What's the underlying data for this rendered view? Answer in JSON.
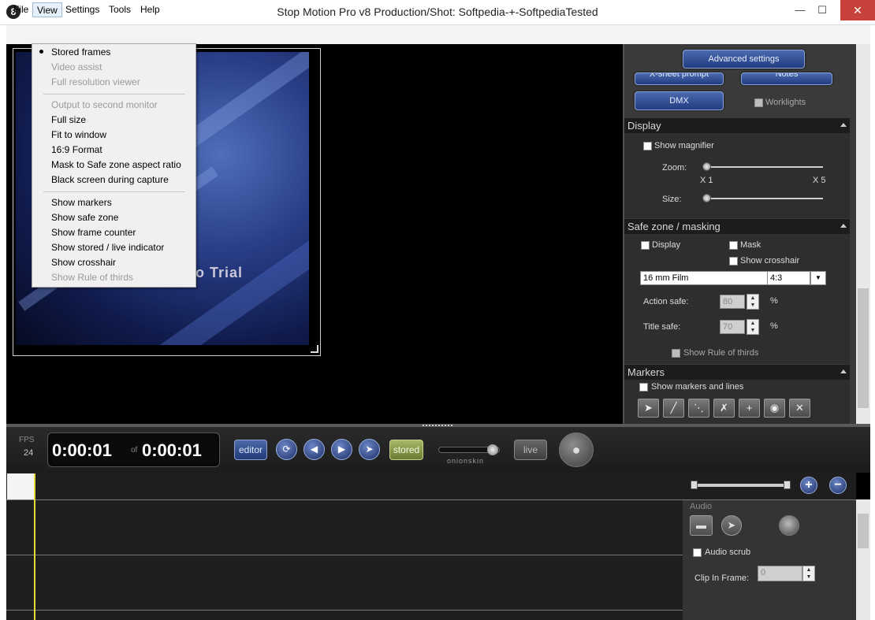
{
  "window": {
    "title": "Stop Motion Pro v8   Production/Shot: Softpedia-+-SoftpediaTested",
    "app_icon_glyph": "8",
    "minimize_glyph": "—",
    "maximize_glyph": "☐",
    "close_glyph": "✕"
  },
  "menubar": {
    "file": "File",
    "view": "View",
    "settings": "Settings",
    "tools": "Tools",
    "help": "Help"
  },
  "view_menu": {
    "stored_frames": "Stored frames",
    "video_assist": "Video assist",
    "full_resolution_viewer": "Full resolution viewer",
    "output_second_monitor": "Output to second monitor",
    "full_size": "Full size",
    "fit_to_window": "Fit to window",
    "format_16_9": "16:9 Format",
    "mask_safe_zone": "Mask to Safe zone aspect ratio",
    "black_screen": "Black screen during capture",
    "show_markers": "Show markers",
    "show_safe_zone": "Show safe zone",
    "show_frame_counter": "Show frame counter",
    "show_stored_live": "Show stored / live indicator",
    "show_crosshair": "Show crosshair",
    "show_rule_of_thirds": "Show Rule of thirds"
  },
  "viewer": {
    "overlay_text": "ro Trial"
  },
  "right_panel": {
    "advanced_settings": "Advanced settings",
    "x_sheet_prompt": "X-sheet prompt",
    "notes": "Notes",
    "dmx": "DMX",
    "worklights": "Worklights",
    "display": {
      "header": "Display",
      "show_magnifier": "Show magnifier",
      "zoom": "Zoom:",
      "zoom_min": "X 1",
      "zoom_max": "X 5",
      "size": "Size:"
    },
    "safe_zone": {
      "header": "Safe zone / masking",
      "display": "Display",
      "mask": "Mask",
      "show_crosshair": "Show crosshair",
      "format": "16 mm Film",
      "aspect": "4:3",
      "action_safe_label": "Action safe:",
      "action_safe_value": "80",
      "title_safe_label": "Title safe:",
      "title_safe_value": "70",
      "percent": "%",
      "show_rule_of_thirds": "Show Rule of thirds"
    },
    "markers": {
      "header": "Markers",
      "show_markers_and_lines": "Show markers and lines"
    }
  },
  "transport": {
    "fps_label": "FPS",
    "fps_value": "24",
    "current_time": "0:00:01",
    "of_label": "of",
    "total_time": "0:00:01",
    "editor": "editor",
    "stored": "stored",
    "live": "live",
    "onionskin": "onionskin"
  },
  "audio": {
    "label": "Audio",
    "audio_scrub": "Audio scrub",
    "clip_in_frame_label": "Clip In Frame:",
    "clip_in_frame_value": "0"
  }
}
